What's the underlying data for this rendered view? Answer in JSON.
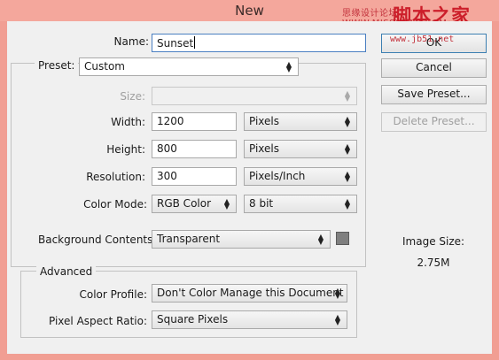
{
  "window": {
    "title": "New"
  },
  "watermark": {
    "line1": "思缘设计论坛 WWW.MISSYUAN.COM",
    "line2": "脚本之家",
    "line3": "www.jb51.net"
  },
  "form": {
    "name_label": "Name:",
    "name_value": "Sunset",
    "preset_label": "Preset:",
    "preset_value": "Custom",
    "size_label": "Size:",
    "size_value": "",
    "width_label": "Width:",
    "width_value": "1200",
    "width_unit": "Pixels",
    "height_label": "Height:",
    "height_value": "800",
    "height_unit": "Pixels",
    "resolution_label": "Resolution:",
    "resolution_value": "300",
    "resolution_unit": "Pixels/Inch",
    "color_mode_label": "Color Mode:",
    "color_mode_value": "RGB Color",
    "bit_depth_value": "8 bit",
    "background_label": "Background Contents:",
    "background_value": "Transparent",
    "background_swatch_color": "#7f7f7f"
  },
  "advanced": {
    "legend": "Advanced",
    "color_profile_label": "Color Profile:",
    "color_profile_value": "Don't Color Manage this Document",
    "pixel_aspect_label": "Pixel Aspect Ratio:",
    "pixel_aspect_value": "Square Pixels"
  },
  "buttons": {
    "ok": "OK",
    "cancel": "Cancel",
    "save_preset": "Save Preset...",
    "delete_preset": "Delete Preset..."
  },
  "image_size": {
    "label": "Image Size:",
    "value": "2.75M"
  },
  "colors": {
    "accent_border": "#3c7fb1",
    "titlebar": "#f4a79c"
  }
}
